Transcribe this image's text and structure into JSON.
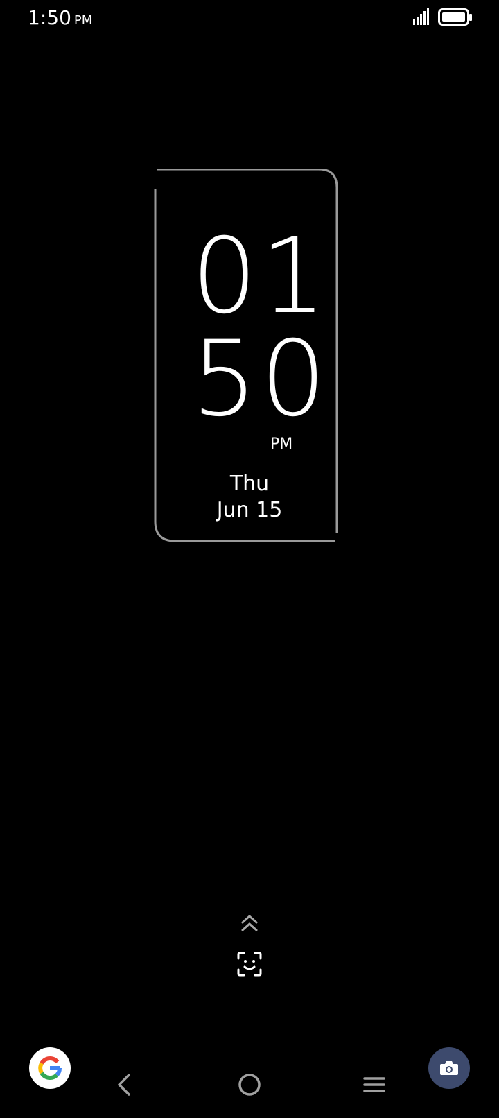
{
  "status_bar": {
    "time": "1:50",
    "ampm": "PM",
    "icons": [
      "signal-icon",
      "battery-icon"
    ]
  },
  "clock": {
    "hour": "01",
    "minute": "50",
    "ampm": "PM",
    "day": "Thu",
    "date": "Jun 15"
  },
  "bottom": {
    "left_shortcut_icon": "google-icon",
    "right_shortcut_icon": "camera-icon",
    "unlock_hint_icon": "double-chevron-up-icon",
    "face_unlock_icon": "face-scan-icon"
  },
  "nav": {
    "back_icon": "back-chevron-icon",
    "home_icon": "home-circle-icon",
    "menu_icon": "menu-icon"
  },
  "colors": {
    "background": "#000000",
    "frame": "#9a9a9a",
    "camera_button": "#3d4a6d",
    "nav_icons": "#a0a0a0"
  }
}
